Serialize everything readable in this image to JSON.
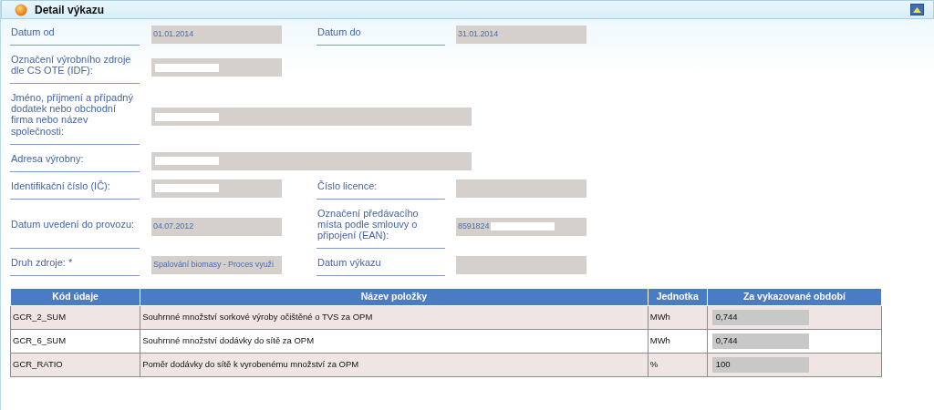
{
  "panel": {
    "title": "Detail výkazu",
    "expanded": true
  },
  "form_rows": [
    {
      "fields": [
        {
          "label": "Datum od",
          "value": "01.01.2014",
          "wide": false,
          "redacted": false
        },
        {
          "label": "Datum do",
          "value": "31.01.2014",
          "wide": false,
          "redacted": false
        }
      ]
    },
    {
      "fields": [
        {
          "label": "Označení výrobního zdroje dle CS OTE (IDF):",
          "wide": false,
          "redacted": true
        }
      ]
    },
    {
      "fields": [
        {
          "label": "Jméno, příjmení a případný dodatek nebo obchodní firma nebo název společnosti:",
          "wide": true,
          "redacted": true
        }
      ]
    },
    {
      "fields": [
        {
          "label": "Adresa výrobny:",
          "wide": true,
          "redacted": true
        }
      ]
    },
    {
      "fields": [
        {
          "label": "Identifikační číslo (IČ):",
          "wide": false,
          "redacted": true
        },
        {
          "label": "Číslo licence:",
          "wide": false,
          "redacted": false
        }
      ]
    },
    {
      "fields": [
        {
          "label": "Datum uvedení do provozu:",
          "value": "04.07.2012",
          "wide": false,
          "redacted": false
        },
        {
          "label": "Označení předávacího místa podle smlouvy o připojení (EAN):",
          "value": "8591824",
          "wide": false,
          "redacted": true
        }
      ]
    },
    {
      "fields": [
        {
          "label": "Druh zdroje: *",
          "value": "Spalování biomasy - Proces využi",
          "wide": false,
          "redacted": false
        },
        {
          "label": "Datum výkazu",
          "wide": false,
          "redacted": false
        }
      ]
    }
  ],
  "table": {
    "columns": [
      "Kód údaje",
      "Název položky",
      "Jednotka",
      "Za vykazované období"
    ],
    "rows": [
      {
        "code": "GCR_2_SUM",
        "name": "Souhrnné množství sorkové výroby očištěné o TVS za OPM",
        "unit": "MWh",
        "value": "0,744"
      },
      {
        "code": "GCR_6_SUM",
        "name": "Souhrnné množství dodávky do sítě za OPM",
        "unit": "MWh",
        "value": "0,744"
      },
      {
        "code": "GCR_RATIO",
        "name": "Poměr dodávky do sítě k vyrobenému množství za OPM",
        "unit": "%",
        "value": "100"
      }
    ]
  }
}
